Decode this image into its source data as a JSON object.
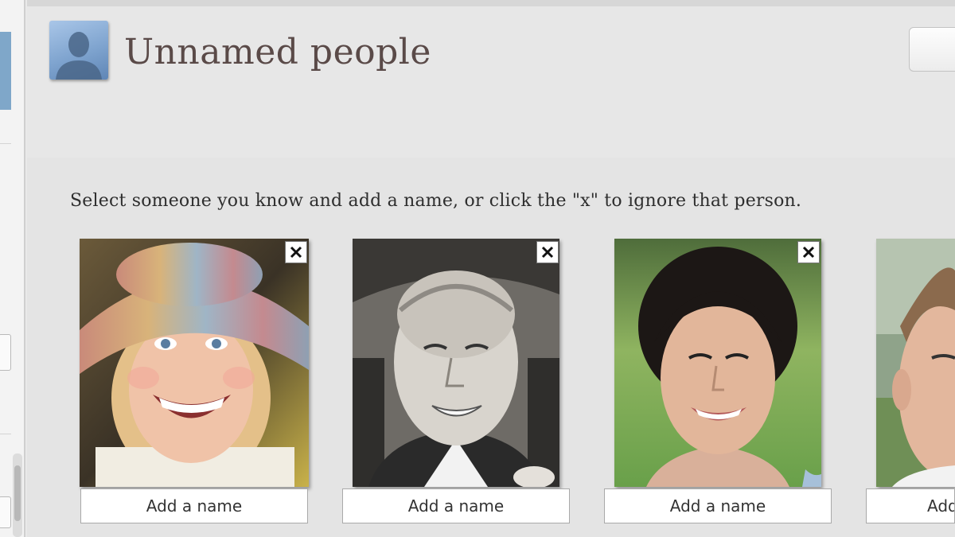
{
  "header": {
    "title": "Unnamed people",
    "avatar_icon": "person-silhouette-icon"
  },
  "instructions": "Select someone you know and add a name, or click the \"x\" to ignore that person.",
  "faces": [
    {
      "id": "child",
      "name_button_label": "Add a name",
      "close_icon": "close-icon"
    },
    {
      "id": "man-bw",
      "name_button_label": "Add a name",
      "close_icon": "close-icon"
    },
    {
      "id": "woman",
      "name_button_label": "Add a name",
      "close_icon": "close-icon"
    },
    {
      "id": "man-partial",
      "name_button_label": "Add a name"
    }
  ],
  "colors": {
    "title": "#5a4a48",
    "background": "#e9e9e9",
    "avatar_blue": "#7fa4cf"
  }
}
